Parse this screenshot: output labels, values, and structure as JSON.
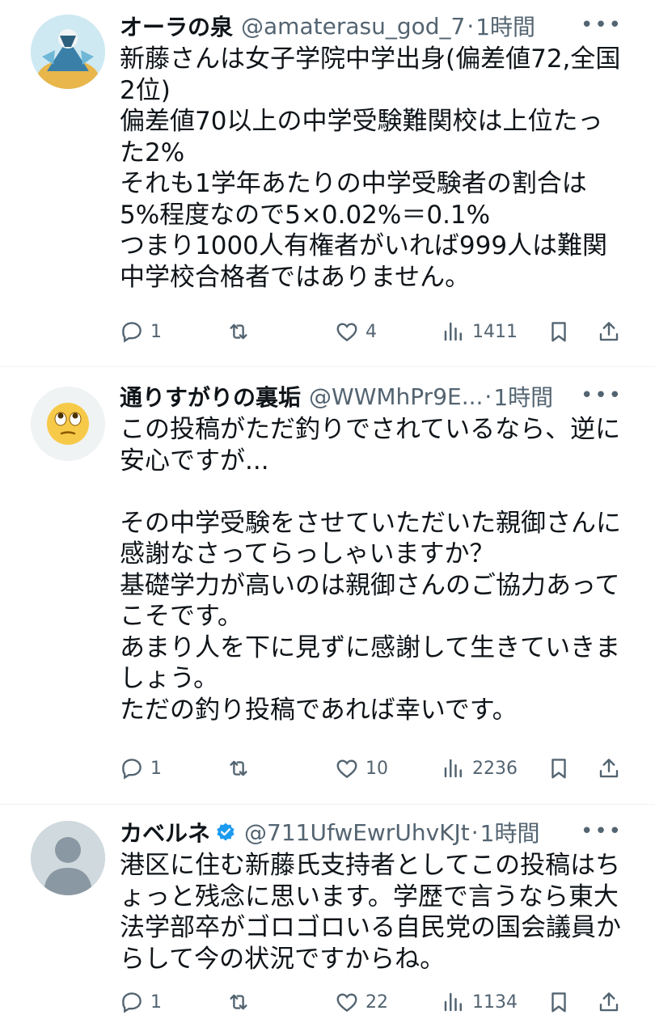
{
  "tweets": [
    {
      "name": "オーラの泉",
      "handle": "@amaterasu_god_7",
      "time": "1時間",
      "text": "新藤さんは女子学院中学出身(偏差値72,全国2位)\n偏差値70以上の中学受験難関校は上位たった2%\nそれも1学年あたりの中学受験者の割合は5%程度なので5×0.02%＝0.1%\nつまり1000人有権者がいれば999人は難関中学校合格者ではありません。",
      "replies": "1",
      "retweets": "",
      "likes": "4",
      "views": "1411"
    },
    {
      "name": "通りすがりの裏垢",
      "handle": "@WWMhPr9E...",
      "time": "1時間",
      "text": "この投稿がただ釣りでされているなら、逆に安心ですが...\n\nその中学受験をさせていただいた親御さんに感謝なさってらっしゃいますか？\n基礎学力が高いのは親御さんのご協力あってこそです。\nあまり人を下に見ずに感謝して生きていきましょう。\nただの釣り投稿であれば幸いです。",
      "replies": "1",
      "retweets": "",
      "likes": "10",
      "views": "2236"
    },
    {
      "name": "カベルネ",
      "handle": "@711UfwEwrUhvKJt",
      "time": "1時間",
      "text": "港区に住む新藤氏支持者としてこの投稿はちょっと残念に思います。学歴で言うなら東大法学部卒がゴロゴロいる自民党の国会議員からして今の状況ですからね。",
      "replies": "1",
      "retweets": "",
      "likes": "22",
      "views": "1134"
    }
  ],
  "icons": {
    "more": "more-icon",
    "reply": "reply-icon",
    "retweet": "retweet-icon",
    "like": "like-icon",
    "views": "views-icon",
    "bookmark": "bookmark-icon",
    "share": "share-icon",
    "verified": "verified-badge-icon"
  },
  "colors": {
    "text": "#0f1419",
    "secondary": "#536471",
    "verified": "#1d9bf0",
    "divider": "#eff3f4"
  }
}
